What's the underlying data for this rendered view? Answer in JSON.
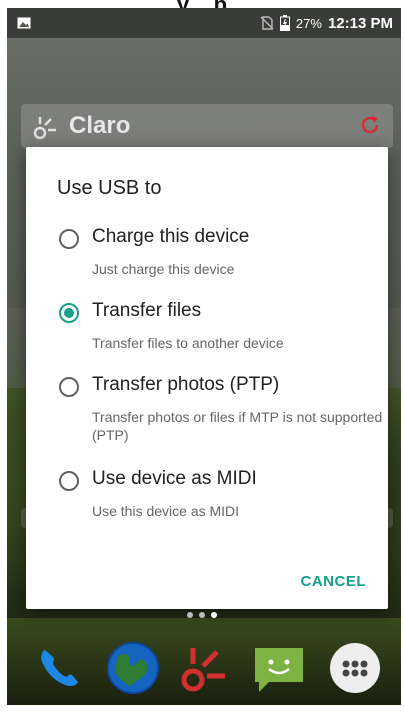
{
  "top_caption": "...y ...p...",
  "status_bar": {
    "battery": "27%",
    "time": "12:13 PM"
  },
  "home_widget": {
    "title": "Claro"
  },
  "dialog": {
    "title": "Use USB to",
    "options": [
      {
        "label": "Charge this device",
        "description": "Just charge this device",
        "selected": false
      },
      {
        "label": "Transfer files",
        "description": "Transfer files to another device",
        "selected": true
      },
      {
        "label": "Transfer photos (PTP)",
        "description": "Transfer photos or files if MTP is not supported (PTP)",
        "selected": false
      },
      {
        "label": "Use device as MIDI",
        "description": "Use this device as MIDI",
        "selected": false
      }
    ],
    "cancel_label": "CANCEL"
  },
  "dock": {
    "icons": [
      "phone-icon",
      "browser-globe-icon",
      "claro-app-icon",
      "messaging-icon",
      "app-drawer-icon"
    ]
  },
  "colors": {
    "accent": "#16a08a",
    "claro_red": "#d32f2f"
  }
}
